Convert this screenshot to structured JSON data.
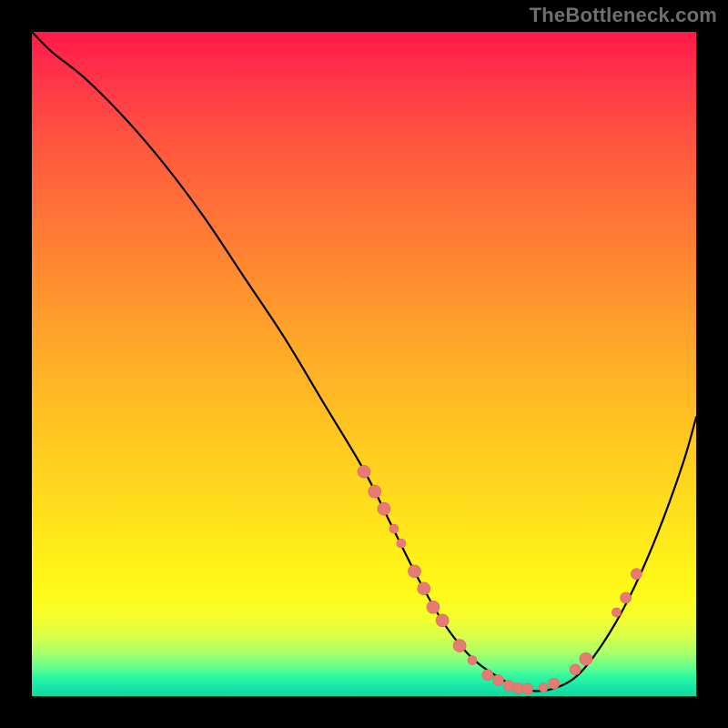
{
  "watermark": "TheBottleneck.com",
  "colors": {
    "background": "#000000",
    "curve": "#000000",
    "marker": "#e77a72"
  },
  "chart_data": {
    "type": "line",
    "title": "",
    "xlabel": "",
    "ylabel": "",
    "xlim": [
      0,
      100
    ],
    "ylim": [
      0,
      100
    ],
    "grid": false,
    "legend": false,
    "series": [
      {
        "name": "bottleneck-curve",
        "x": [
          0,
          3,
          8,
          14,
          20,
          26,
          32,
          38,
          44,
          50,
          54,
          58,
          62,
          66,
          70,
          74,
          78,
          82,
          86,
          90,
          94,
          98,
          100
        ],
        "y": [
          100,
          97,
          93,
          87,
          80,
          72,
          63,
          54,
          44,
          34,
          26,
          18,
          11,
          6,
          3,
          1,
          1,
          3,
          8,
          15,
          24,
          35,
          42
        ]
      }
    ],
    "markers": [
      {
        "x": 50.0,
        "y": 33.8,
        "r": 7
      },
      {
        "x": 51.6,
        "y": 30.8,
        "r": 7
      },
      {
        "x": 53.0,
        "y": 28.2,
        "r": 7
      },
      {
        "x": 54.5,
        "y": 25.2,
        "r": 5
      },
      {
        "x": 55.6,
        "y": 23.0,
        "r": 5
      },
      {
        "x": 57.6,
        "y": 18.8,
        "r": 7
      },
      {
        "x": 59.0,
        "y": 16.2,
        "r": 7
      },
      {
        "x": 60.4,
        "y": 13.4,
        "r": 7
      },
      {
        "x": 61.8,
        "y": 11.4,
        "r": 7
      },
      {
        "x": 64.4,
        "y": 7.6,
        "r": 7
      },
      {
        "x": 66.3,
        "y": 5.4,
        "r": 5
      },
      {
        "x": 68.6,
        "y": 3.2,
        "r": 6
      },
      {
        "x": 70.2,
        "y": 2.4,
        "r": 6
      },
      {
        "x": 71.8,
        "y": 1.6,
        "r": 6
      },
      {
        "x": 73.2,
        "y": 1.2,
        "r": 6
      },
      {
        "x": 74.6,
        "y": 1.1,
        "r": 6
      },
      {
        "x": 77.0,
        "y": 1.3,
        "r": 5
      },
      {
        "x": 78.6,
        "y": 1.9,
        "r": 6
      },
      {
        "x": 81.8,
        "y": 4.0,
        "r": 6
      },
      {
        "x": 83.4,
        "y": 5.6,
        "r": 7
      },
      {
        "x": 88.0,
        "y": 12.6,
        "r": 5
      },
      {
        "x": 89.4,
        "y": 14.8,
        "r": 6
      },
      {
        "x": 91.0,
        "y": 18.4,
        "r": 6
      }
    ]
  }
}
